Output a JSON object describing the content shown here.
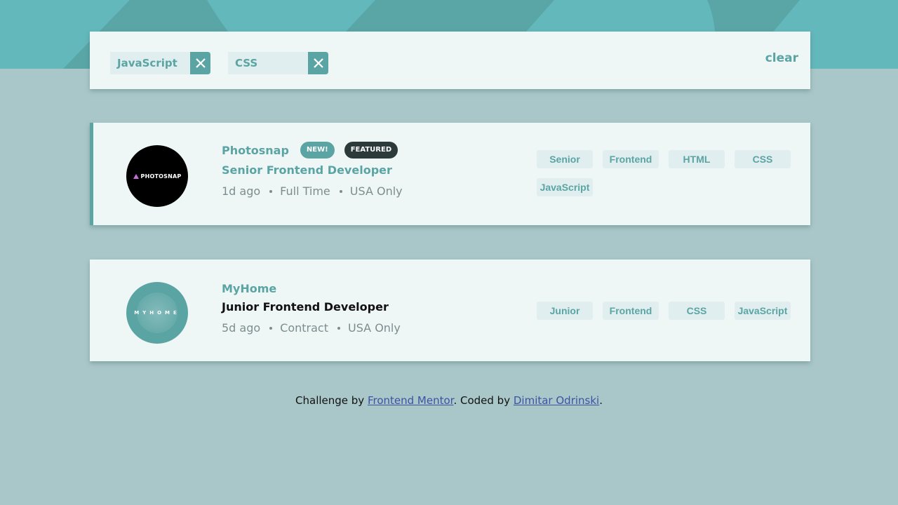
{
  "filter_bar": {
    "chips": [
      {
        "label": "JavaScript"
      },
      {
        "label": "CSS"
      }
    ],
    "clear_label": "clear"
  },
  "jobs": [
    {
      "logo_text": "PHOTOSNAP",
      "company": "Photosnap",
      "new_badge": "NEW!",
      "featured_badge": "FEATURED",
      "position": "Senior Frontend Developer",
      "posted": "1d ago",
      "contract": "Full Time",
      "location": "USA Only",
      "tags": [
        "Senior",
        "Frontend",
        "HTML",
        "CSS",
        "JavaScript"
      ]
    },
    {
      "logo_text": "MYHOME",
      "company": "MyHome",
      "position": "Junior Frontend Developer",
      "posted": "5d ago",
      "contract": "Contract",
      "location": "USA Only",
      "tags": [
        "Junior",
        "Frontend",
        "CSS",
        "JavaScript"
      ]
    }
  ],
  "footer": {
    "prefix": "Challenge by ",
    "link1": "Frontend Mentor",
    "middle": ". Coded by ",
    "link2": "Dimitar Odrinski",
    "suffix": "."
  },
  "colors": {
    "primary": "#5ba4a4",
    "background": "#a9c7c8",
    "header": "#63b8bb",
    "card": "#eff6f6",
    "tag_bg": "#e0eeef",
    "featured": "#2c3a3a"
  }
}
